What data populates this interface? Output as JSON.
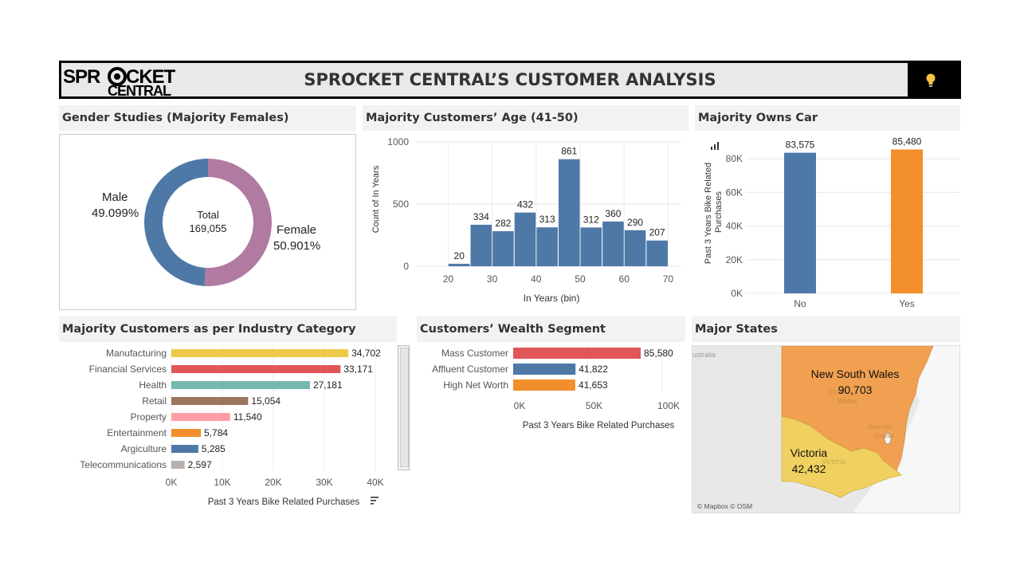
{
  "header": {
    "title": "SPROCKET CENTRAL’S CUSTOMER ANALYSIS",
    "logo_top": "SPR",
    "logo_top2": "CKET",
    "logo_bottom": "CENTRAL",
    "bulb_icon": "lightbulb-icon"
  },
  "gender": {
    "title": "Gender Studies (Majority Females)",
    "total_label": "Total",
    "total_value": "169,055",
    "male_label": "Male",
    "male_pct": "49.099%",
    "female_label": "Female",
    "female_pct": "50.901%"
  },
  "age": {
    "title": "Majority Customers’ Age (41-50)"
  },
  "car": {
    "title": "Majority Owns Car",
    "chart_icon": "bar-chart-icon"
  },
  "industry": {
    "title": "Majority Customers as per Industry Category",
    "sort_icon": "sort-icon"
  },
  "wealth": {
    "title": "Customers’ Wealth Segment"
  },
  "states": {
    "title": "Major States",
    "nsw_name": "New South Wales",
    "nsw_value": "90,703",
    "vic_name": "Victoria",
    "vic_value": "42,432",
    "attribution": "© Mapbox © OSM",
    "bg_australia": "ustralia",
    "bg_south": "South",
    "bg_wales": "Wales",
    "bg_act1": "Australia",
    "bg_act2": "Capital",
    "bg_victoria": "Victoria"
  },
  "colors": {
    "blue": "#4e79a7",
    "purple": "#b07aa1",
    "orange": "#f28e2b",
    "nsw": "#f0a050",
    "vic": "#f0d060"
  },
  "chart_data": [
    {
      "type": "pie",
      "title": "Gender Studies (Majority Females)",
      "categories": [
        "Male",
        "Female"
      ],
      "values": [
        49.099,
        50.901
      ],
      "total": 169055,
      "colors": [
        "#4e79a7",
        "#b07aa1"
      ]
    },
    {
      "type": "bar",
      "title": "Majority Customers’ Age (41-50)",
      "bin_starts": [
        15,
        20,
        25,
        30,
        35,
        40,
        45,
        50,
        55,
        60,
        65
      ],
      "bin_width": 5,
      "values": [
        null,
        20,
        334,
        282,
        432,
        313,
        861,
        312,
        360,
        290,
        207
      ],
      "xlabel": "In Years (bin)",
      "ylabel": "Count of In Years",
      "xticks": [
        20,
        30,
        40,
        50,
        60,
        70
      ],
      "yticks": [
        0,
        500,
        1000
      ],
      "xlim": [
        12.5,
        73
      ],
      "ylim": [
        0,
        1000
      ],
      "color": "#4e79a7"
    },
    {
      "type": "bar",
      "title": "Majority Owns Car",
      "categories": [
        "No",
        "Yes"
      ],
      "values": [
        83575,
        85480
      ],
      "value_labels": [
        "83,575",
        "85,480"
      ],
      "ylabel": "Past 3 Years Bike Related Purchases",
      "yticks": [
        0,
        20000,
        40000,
        60000,
        80000
      ],
      "ytick_labels": [
        "0K",
        "20K",
        "40K",
        "60K",
        "80K"
      ],
      "ylim": [
        0,
        90000
      ],
      "colors": [
        "#4e79a7",
        "#f28e2b"
      ]
    },
    {
      "type": "bar",
      "orientation": "horizontal",
      "title": "Majority Customers as per Industry Category",
      "categories": [
        "Manufacturing",
        "Financial Services",
        "Health",
        "Retail",
        "Property",
        "Entertainment",
        "Argiculture",
        "Telecommunications"
      ],
      "values": [
        34702,
        33171,
        27181,
        15054,
        11540,
        5784,
        5285,
        2597
      ],
      "value_labels": [
        "34,702",
        "33,171",
        "27,181",
        "15,054",
        "11,540",
        "5,784",
        "5,285",
        "2,597"
      ],
      "colors": [
        "#edc948",
        "#e15759",
        "#76b7b2",
        "#9c755f",
        "#ff9da7",
        "#f28e2b",
        "#4e79a7",
        "#bab0ac"
      ],
      "xlabel": "Past 3 Years Bike Related Purchases",
      "xticks": [
        0,
        10000,
        20000,
        30000,
        40000
      ],
      "xtick_labels": [
        "0K",
        "10K",
        "20K",
        "30K",
        "40K"
      ],
      "xlim": [
        0,
        40000
      ]
    },
    {
      "type": "bar",
      "orientation": "horizontal",
      "title": "Customers’ Wealth Segment",
      "categories": [
        "Mass Customer",
        "Affluent Customer",
        "High Net Worth"
      ],
      "values": [
        85580,
        41822,
        41653
      ],
      "value_labels": [
        "85,580",
        "41,822",
        "41,653"
      ],
      "colors": [
        "#e15759",
        "#4e79a7",
        "#f28e2b"
      ],
      "xlabel": "Past 3 Years Bike Related Purchases",
      "xticks": [
        0,
        50000,
        100000
      ],
      "xtick_labels": [
        "0K",
        "50K",
        "100K"
      ],
      "xlim": [
        0,
        100000
      ]
    }
  ]
}
